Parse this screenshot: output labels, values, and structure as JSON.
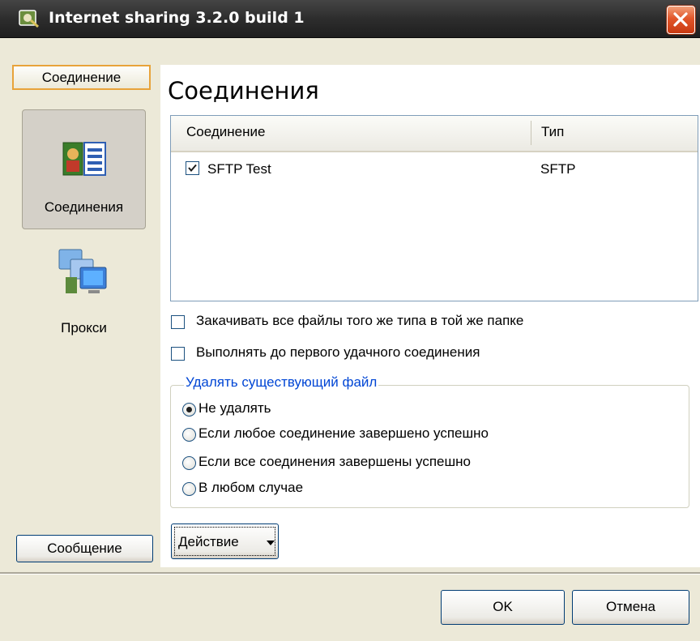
{
  "window": {
    "title": "Internet sharing 3.2.0 build 1"
  },
  "sidebar": {
    "header_button": "Соединение",
    "items": [
      {
        "label": "Соединения",
        "icon": "connections-icon",
        "selected": true
      },
      {
        "label": "Прокси",
        "icon": "proxy-computers-icon",
        "selected": false
      }
    ],
    "footer_button": "Сообщение"
  },
  "main": {
    "title": "Соединения",
    "table": {
      "columns": [
        "Соединение",
        "Тип"
      ],
      "rows": [
        {
          "name": "SFTP Test",
          "type": "SFTP",
          "checked": true
        }
      ]
    },
    "options": [
      {
        "label": "Закачивать все файлы того же типа в той же папке",
        "checked": false
      },
      {
        "label": "Выполнять до первого удачного соединения",
        "checked": false
      }
    ],
    "delete_group": {
      "legend": "Удалять существующий файл",
      "choices": [
        {
          "label": "Не удалять",
          "selected": true
        },
        {
          "label": "Если любое соединение завершено успешно",
          "selected": false
        },
        {
          "label": "Если все соединения завершены успешно",
          "selected": false
        },
        {
          "label": "В любом случае",
          "selected": false
        }
      ]
    },
    "action_button": "Действие"
  },
  "footer": {
    "ok": "OK",
    "cancel": "Отмена"
  },
  "colors": {
    "accent_border": "#e8a33a",
    "legend_text": "#0046d5",
    "close_button": "#e2562a"
  }
}
